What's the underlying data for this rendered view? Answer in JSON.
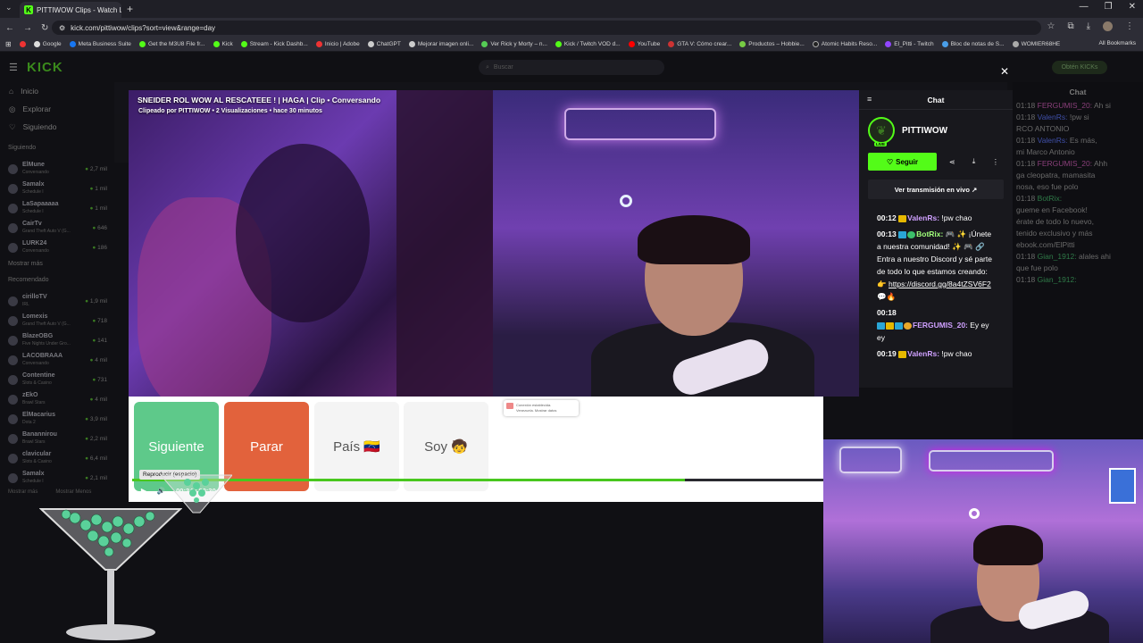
{
  "browser": {
    "tab_title": "PITTIWOW Clips - Watch Live o",
    "url": "kick.com/pittiwow/clips?sort=view&range=day",
    "bookmarks": [
      "Google",
      "Meta Business Suite",
      "Get the M3U8 File fr...",
      "Kick",
      "Stream - Kick Dashb...",
      "Inicio | Adobe",
      "ChatGPT",
      "Mejorar imagen onli...",
      "Ver Rick y Morty – n...",
      "Kick / Twitch VOD d...",
      "YouTube",
      "GTA V: Cómo crear...",
      "Productos – Hobbie...",
      "Atomic Habits Reso...",
      "El_Pitti - Twitch",
      "Bloc de notas de S...",
      "WOMIER68HE"
    ],
    "all_bookmarks": "All Bookmarks"
  },
  "kick": {
    "logo": "KICK",
    "search_placeholder": "Buscar",
    "obtain_label": "Obtén KICKs",
    "nav": {
      "home": "Inicio",
      "explore": "Explorar",
      "following": "Siguiendo"
    },
    "following_heading": "Siguiendo",
    "following": [
      {
        "name": "ElMune",
        "sub": "Conversando",
        "viewers": "2,7 mil"
      },
      {
        "name": "Samalx",
        "sub": "Schedule I",
        "viewers": "1 mil"
      },
      {
        "name": "LaSapaaaaa",
        "sub": "Schedule I",
        "viewers": "1 mil"
      },
      {
        "name": "CairTv",
        "sub": "Grand Theft Auto V (G...",
        "viewers": "646"
      },
      {
        "name": "LURK24",
        "sub": "Conversando",
        "viewers": "186"
      }
    ],
    "show_more": "Mostrar más",
    "recommended_heading": "Recomendado",
    "recommended": [
      {
        "name": "cirilloTV",
        "sub": "IRL",
        "viewers": "1,9 mil"
      },
      {
        "name": "Lomexis",
        "sub": "Grand Theft Auto V (G...",
        "viewers": "718"
      },
      {
        "name": "BlazeOBG",
        "sub": "Five Nights Under Gro...",
        "viewers": "141"
      },
      {
        "name": "LACOBRAAA",
        "sub": "Conversando",
        "viewers": "4 mil"
      },
      {
        "name": "Contentine",
        "sub": "Slots & Casino",
        "viewers": "731"
      },
      {
        "name": "zEkO",
        "sub": "Brawl Stars",
        "viewers": "4 mil"
      },
      {
        "name": "ElMacarius",
        "sub": "Dota 2",
        "viewers": "3,9 mil"
      },
      {
        "name": "Banannirou",
        "sub": "Brawl Stars",
        "viewers": "2,2 mil"
      },
      {
        "name": "clavicular",
        "sub": "Slots & Casino",
        "viewers": "6,4 mil"
      },
      {
        "name": "Samalx",
        "sub": "Schedule I",
        "viewers": "2,1 mil"
      }
    ],
    "show_more_2": "Mostrar más",
    "show_less": "Mostrar Menos",
    "right_chat": {
      "title": "Chat",
      "messages": [
        {
          "ts": "01:18",
          "user": "FERGUMIS_20:",
          "text": "Ah si",
          "cls": "u3"
        },
        {
          "ts": "01:18",
          "user": "ValenRs:",
          "text": "!pw si",
          "cls": "u2"
        },
        {
          "ts": "",
          "user": "",
          "text": "RCO ANTONIO",
          "cls": ""
        },
        {
          "ts": "01:18",
          "user": "ValenRs:",
          "text": "Es más,",
          "cls": "u2"
        },
        {
          "ts": "",
          "user": "",
          "text": "mi Marco Antonio",
          "cls": ""
        },
        {
          "ts": "01:18",
          "user": "FERGUMIS_20:",
          "text": "Ahh",
          "cls": "u3"
        },
        {
          "ts": "",
          "user": "",
          "text": "ga cleopatra, mamasita",
          "cls": ""
        },
        {
          "ts": "",
          "user": "",
          "text": "nosa, eso fue polo",
          "cls": ""
        },
        {
          "ts": "01:18",
          "user": "BotRix:",
          "text": "",
          "cls": "u1"
        },
        {
          "ts": "",
          "user": "",
          "text": "gueme en Facebook!",
          "cls": ""
        },
        {
          "ts": "",
          "user": "",
          "text": "érate de todo lo nuevo,",
          "cls": ""
        },
        {
          "ts": "",
          "user": "",
          "text": "tenido exclusivo y más",
          "cls": ""
        },
        {
          "ts": "",
          "user": "",
          "text": "ebook.com/ElPitti",
          "cls": ""
        },
        {
          "ts": "01:18",
          "user": "Gian_1912:",
          "text": "alales ahi",
          "cls": "u1"
        },
        {
          "ts": "",
          "user": "",
          "text": "que fue polo",
          "cls": ""
        },
        {
          "ts": "01:18",
          "user": "Gian_1912:",
          "text": "",
          "cls": "u1"
        }
      ]
    },
    "clip": {
      "title": "SNEIDER ROL WOW AL RESCATEEE ! | HAGA | Clip • Conversando",
      "meta": "Clipeado por PITTIWOW • 2 Visualizaciones • hace 30 minutos",
      "time": "00:24 / 00:30",
      "tooltip": "Reproducir (espacio)",
      "progress": 0.8
    },
    "clip_chat": {
      "title": "Chat",
      "channel": "PITTIWOW",
      "live_badge": "LIVE",
      "follow_label": "Seguir",
      "watch_live": "Ver transmisión en vivo",
      "messages": [
        {
          "ts": "00:12",
          "user": "ValenRs:",
          "text": "!pw chao"
        },
        {
          "ts": "00:13",
          "user": "BotRix:",
          "text": "🎮 ✨ ¡Únete a nuestra comunidad! ✨ 🎮 🔗 Entra a nuestro Discord y sé parte de todo lo que estamos creando: 👉",
          "link": "https://discord.gg/8a4tZSV6F2"
        },
        {
          "ts": "00:18",
          "user": "FERGUMIS_20:",
          "text": "Ey ey ey"
        },
        {
          "ts": "00:19",
          "user": "ValenRs:",
          "text": "!pw chao"
        }
      ]
    },
    "buttons": {
      "next": "Siguiente",
      "stop": "Parar",
      "country": "País 🇻🇪",
      "soy": "Soy 🧒"
    },
    "notification": {
      "line1": "Conexión establecida.",
      "line2": "Venezuela. Mostrar datos"
    }
  },
  "colors": {
    "kick_green": "#53fc18",
    "stop_orange": "#e2623c",
    "next_green": "#5ec98a"
  }
}
